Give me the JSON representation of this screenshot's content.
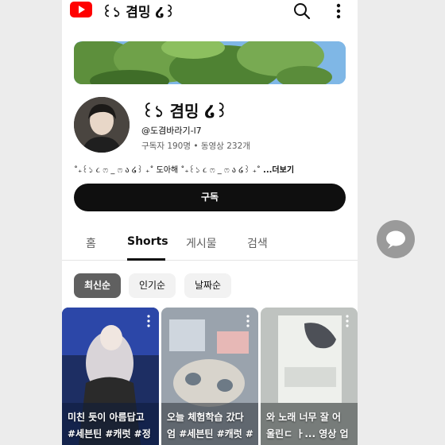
{
  "header": {
    "title": "꒰১ 겸밍 ໒꒱",
    "logo_icon": "youtube-logo",
    "search_icon": "search-icon",
    "more_icon": "more-vertical-icon"
  },
  "channel": {
    "name": "꒰১ 겸밍 ໒꒱",
    "handle": "@도겸바라기-l7",
    "stats": "구독자 190명 • 동영상 232개",
    "description": "˚₊꒰১ ૮ ෆ _ ෆ ა ໒꒱ ₊˚ 도아해 ˚₊꒰১ ૮ ෆ _ ෆ ა ໒꒱ ₊˚ ",
    "more_label": "...더보기",
    "subscribe_label": "구독"
  },
  "tabs": [
    {
      "label": "홈",
      "active": false
    },
    {
      "label": "Shorts",
      "active": true
    },
    {
      "label": "게시물",
      "active": false
    },
    {
      "label": "검색",
      "active": false
    }
  ],
  "chips": [
    {
      "label": "최신순",
      "active": true
    },
    {
      "label": "인기순",
      "active": false
    },
    {
      "label": "날짜순",
      "active": false
    }
  ],
  "shorts": [
    {
      "line1": "미친 듯이 아름답고",
      "line2": "#세븐틴 #캐럿 #정"
    },
    {
      "line1": "오늘 체험학습 갔다",
      "line2": "엄 #세븐틴 #캐럿 #"
    },
    {
      "line1": "와 노래 너무 잘 어",
      "line2": "울린ㄷ ㅏ... 영상 업"
    }
  ],
  "floating_button": {
    "icon": "chat-bubble-icon"
  },
  "colors": {
    "accent_red": "#ff0000",
    "subscribe_bg": "#0f0f0f",
    "chip_active": "#606060"
  }
}
